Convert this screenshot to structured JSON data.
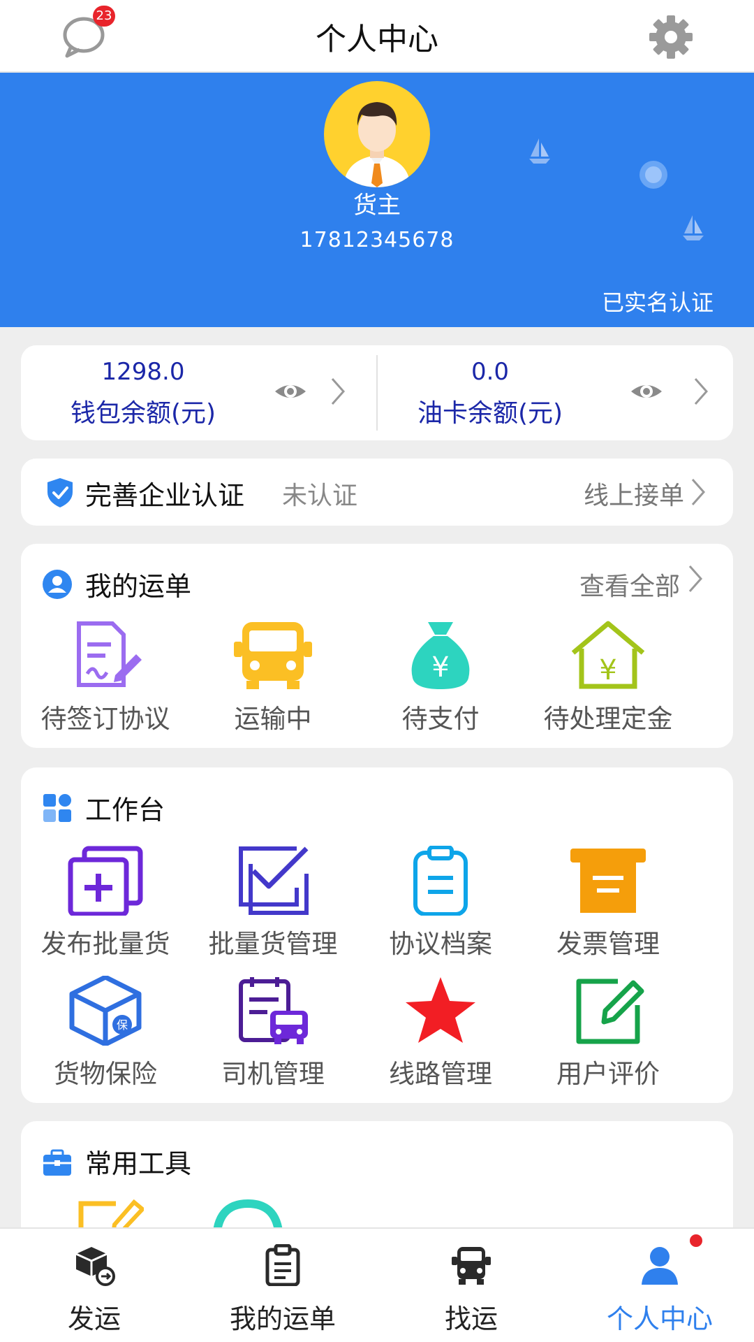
{
  "header": {
    "title": "个人中心",
    "message_badge": "23"
  },
  "profile": {
    "role": "货主",
    "phone": "17812345678",
    "verification": "已实名认证"
  },
  "wallet": {
    "balance": {
      "amount": "1298.0",
      "label": "钱包余额(元)"
    },
    "fuel_card": {
      "amount": "0.0",
      "label": "油卡余额(元)"
    }
  },
  "enterprise_auth": {
    "title": "完善企业认证",
    "status": "未认证",
    "action": "线上接单"
  },
  "orders": {
    "title": "我的运单",
    "view_all": "查看全部",
    "items": [
      {
        "label": "待签订协议",
        "icon": "contract-sign-icon"
      },
      {
        "label": "运输中",
        "icon": "truck-icon"
      },
      {
        "label": "待支付",
        "icon": "money-bag-icon"
      },
      {
        "label": "待处理定金",
        "icon": "deposit-house-icon"
      }
    ]
  },
  "workbench": {
    "title": "工作台",
    "items": [
      {
        "label": "发布批量货",
        "icon": "publish-batch-icon"
      },
      {
        "label": "批量货管理",
        "icon": "batch-manage-icon"
      },
      {
        "label": "协议档案",
        "icon": "clipboard-icon"
      },
      {
        "label": "发票管理",
        "icon": "invoice-icon"
      },
      {
        "label": "货物保险",
        "icon": "insurance-box-icon"
      },
      {
        "label": "司机管理",
        "icon": "driver-manage-icon"
      },
      {
        "label": "线路管理",
        "icon": "star-icon"
      },
      {
        "label": "用户评价",
        "icon": "review-edit-icon"
      }
    ]
  },
  "tools": {
    "title": "常用工具"
  },
  "tabbar": {
    "items": [
      {
        "label": "发运",
        "icon": "ship-box-icon"
      },
      {
        "label": "我的运单",
        "icon": "waybill-icon"
      },
      {
        "label": "找运",
        "icon": "truck-front-icon"
      },
      {
        "label": "个人中心",
        "icon": "person-icon",
        "active": true
      }
    ]
  },
  "colors": {
    "primary": "#2f80ed",
    "wallet_text": "#1b27a8",
    "badge": "#e8242b"
  }
}
